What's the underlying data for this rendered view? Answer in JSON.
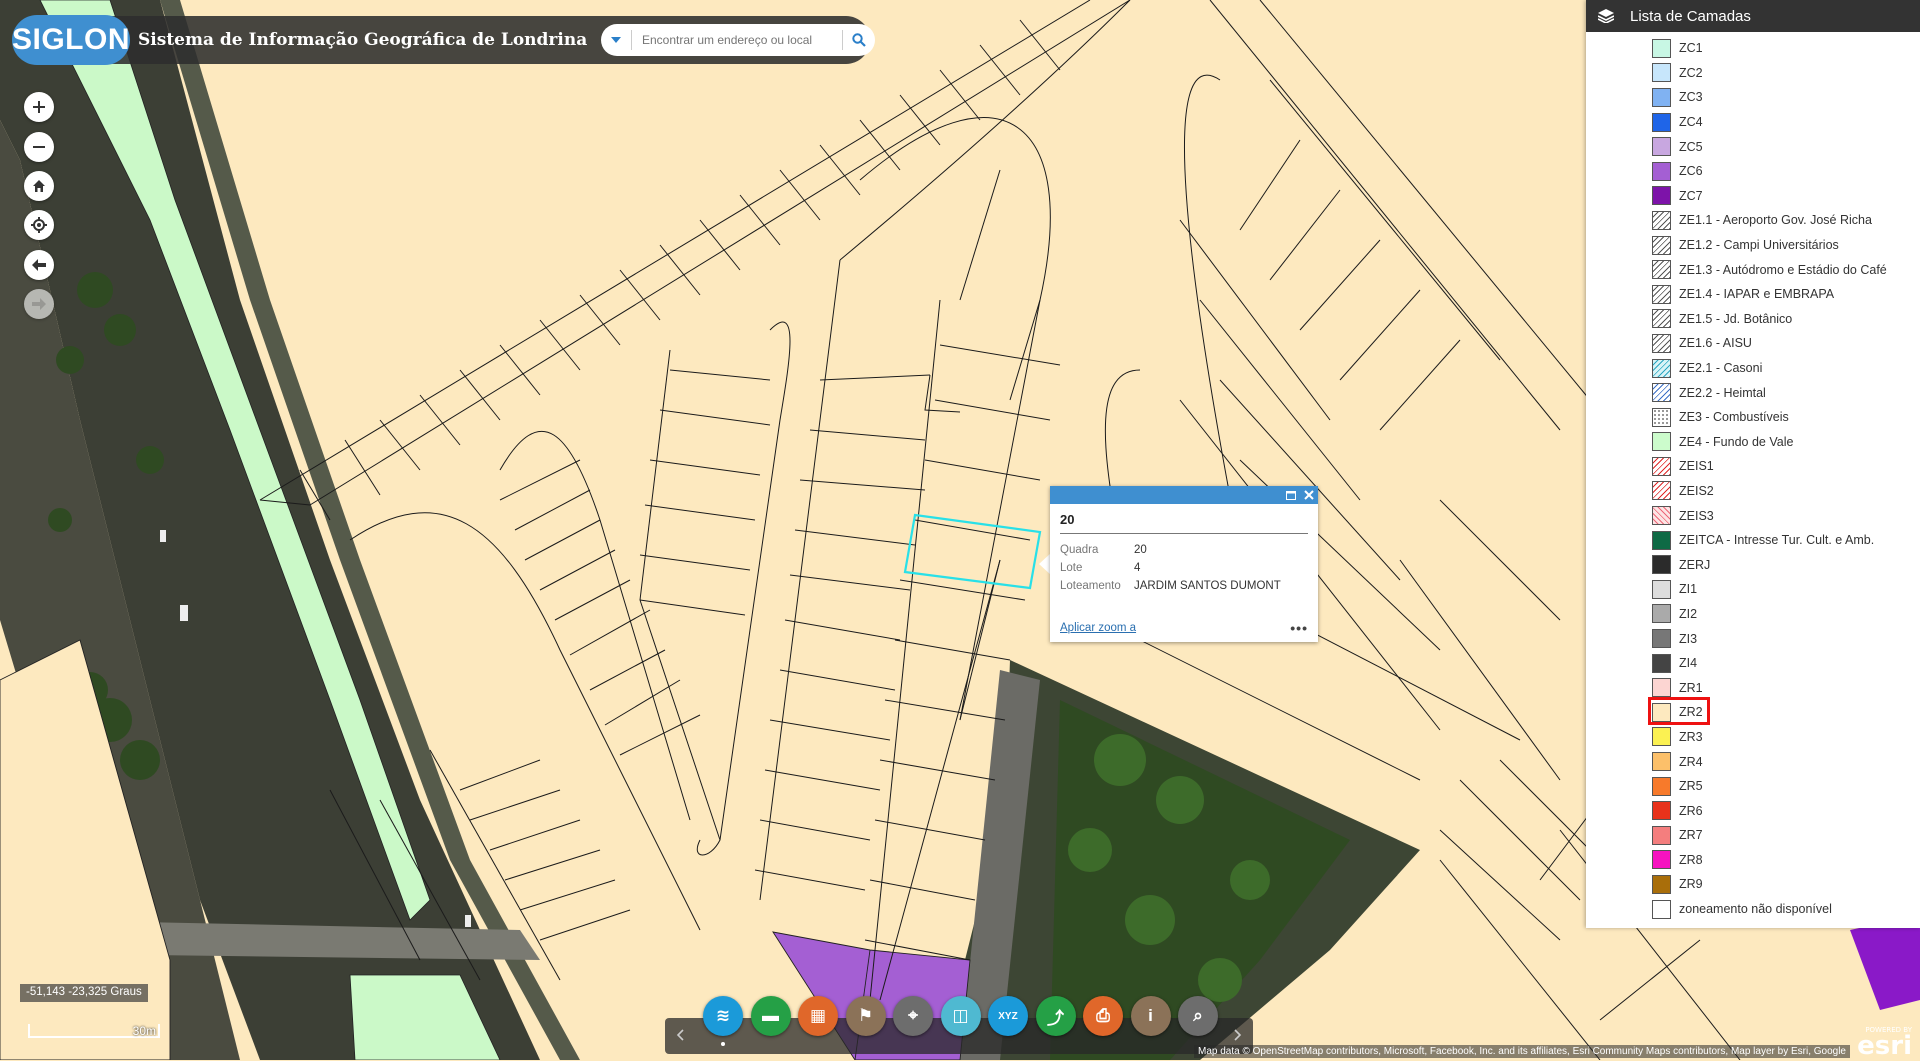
{
  "header": {
    "logo_text": "SIGLON",
    "title": "Sistema de Informação Geográfica de Londrina",
    "search_placeholder": "Encontrar um endereço ou local"
  },
  "layers_panel": {
    "title": "Lista de Camadas",
    "items": [
      {
        "label": "ZC1",
        "color": "#c8f7e4",
        "pattern": "solid"
      },
      {
        "label": "ZC2",
        "color": "#c7e6fb",
        "pattern": "solid"
      },
      {
        "label": "ZC3",
        "color": "#80b2f2",
        "pattern": "solid"
      },
      {
        "label": "ZC4",
        "color": "#1f65e8",
        "pattern": "solid"
      },
      {
        "label": "ZC5",
        "color": "#c8a7e0",
        "pattern": "solid"
      },
      {
        "label": "ZC6",
        "color": "#a45fd3",
        "pattern": "solid"
      },
      {
        "label": "ZC7",
        "color": "#7d13a9",
        "pattern": "solid"
      },
      {
        "label": "ZE1.1 - Aeroporto Gov. José Richa",
        "color": "#ffffff",
        "pattern": "hatch"
      },
      {
        "label": "ZE1.2 - Campi Universitários",
        "color": "#ffffff",
        "pattern": "hatch"
      },
      {
        "label": "ZE1.3 - Autódromo e Estádio do Café",
        "color": "#ffffff",
        "pattern": "hatch"
      },
      {
        "label": "ZE1.4 - IAPAR e EMBRAPA",
        "color": "#ffffff",
        "pattern": "hatch"
      },
      {
        "label": "ZE1.5 - Jd. Botânico",
        "color": "#ffffff",
        "pattern": "hatch"
      },
      {
        "label": "ZE1.6 - AISU",
        "color": "#ffffff",
        "pattern": "hatch"
      },
      {
        "label": "ZE2.1 - Casoni",
        "color": "#d8f4f7",
        "pattern": "hatch-c"
      },
      {
        "label": "ZE2.2 - Heimtal",
        "color": "#ffffff",
        "pattern": "hatch-b"
      },
      {
        "label": "ZE3 - Combustíveis",
        "color": "#ffffff",
        "pattern": "dots"
      },
      {
        "label": "ZE4 - Fundo de Vale",
        "color": "#ccfccc",
        "pattern": "solid"
      },
      {
        "label": "ZEIS1",
        "color": "#ffffff",
        "pattern": "hatch-r"
      },
      {
        "label": "ZEIS2",
        "color": "#ffffff",
        "pattern": "hatch-r"
      },
      {
        "label": "ZEIS3",
        "color": "#fce4e4",
        "pattern": "cross-r"
      },
      {
        "label": "ZEITCA - Intresse Tur. Cult. e Amb.",
        "color": "#0e6a45",
        "pattern": "solid"
      },
      {
        "label": "ZERJ",
        "color": "#2b2b2b",
        "pattern": "solid"
      },
      {
        "label": "ZI1",
        "color": "#dddddd",
        "pattern": "solid"
      },
      {
        "label": "ZI2",
        "color": "#aaaaaa",
        "pattern": "solid"
      },
      {
        "label": "ZI3",
        "color": "#777777",
        "pattern": "solid"
      },
      {
        "label": "ZI4",
        "color": "#444444",
        "pattern": "solid"
      },
      {
        "label": "ZR1",
        "color": "#fcd5d2",
        "pattern": "solid"
      },
      {
        "label": "ZR2",
        "color": "#fde9bf",
        "pattern": "solid"
      },
      {
        "label": "ZR3",
        "color": "#fbf152",
        "pattern": "solid"
      },
      {
        "label": "ZR4",
        "color": "#fcc06a",
        "pattern": "solid"
      },
      {
        "label": "ZR5",
        "color": "#f77a2b",
        "pattern": "solid"
      },
      {
        "label": "ZR6",
        "color": "#e8321b",
        "pattern": "solid"
      },
      {
        "label": "ZR7",
        "color": "#f47e7e",
        "pattern": "solid"
      },
      {
        "label": "ZR8",
        "color": "#f613c0",
        "pattern": "solid"
      },
      {
        "label": "ZR9",
        "color": "#a96e0a",
        "pattern": "solid"
      },
      {
        "label": "zoneamento não disponível",
        "color": "#ffffff",
        "pattern": "solid"
      }
    ]
  },
  "popup": {
    "title": "20",
    "fields": [
      {
        "key": "Quadra",
        "value": "20"
      },
      {
        "key": "Lote",
        "value": "4"
      },
      {
        "key": "Loteamento",
        "value": "JARDIM SANTOS DUMONT"
      }
    ],
    "zoom_link": "Aplicar zoom a",
    "more_label": "•••"
  },
  "status": {
    "coordinates": "-51,143 -23,325 Graus",
    "scale_label": "30m"
  },
  "toolbar": {
    "tools": [
      {
        "name": "layers-tool",
        "color": "#1b9ad9",
        "glyph": "≋"
      },
      {
        "name": "measure-tool",
        "color": "#25a046",
        "glyph": "▬"
      },
      {
        "name": "basemap-tool",
        "color": "#e0672a",
        "glyph": "▦"
      },
      {
        "name": "filter-tool",
        "color": "#8b7258",
        "glyph": "⚑"
      },
      {
        "name": "locate-tool",
        "color": "#6d6d6d",
        "glyph": "⌖"
      },
      {
        "name": "swipe-tool",
        "color": "#4fb9d1",
        "glyph": "◫"
      },
      {
        "name": "xyz-tool",
        "color": "#1b9ad9",
        "glyph": "XYZ"
      },
      {
        "name": "share-tool",
        "color": "#25a046",
        "glyph": "⤴"
      },
      {
        "name": "print-tool",
        "color": "#e0672a",
        "glyph": "⎙"
      },
      {
        "name": "info-tool",
        "color": "#8b7258",
        "glyph": "i"
      },
      {
        "name": "query-tool",
        "color": "#6d6d6d",
        "glyph": "⌕"
      }
    ]
  },
  "attribution": "Map data © OpenStreetMap contributors, Microsoft, Facebook, Inc. and its affiliates, Esri Community Maps contributors, Map layer by Esri, Google",
  "esri": {
    "powered": "POWERED BY",
    "brand": "esri"
  }
}
